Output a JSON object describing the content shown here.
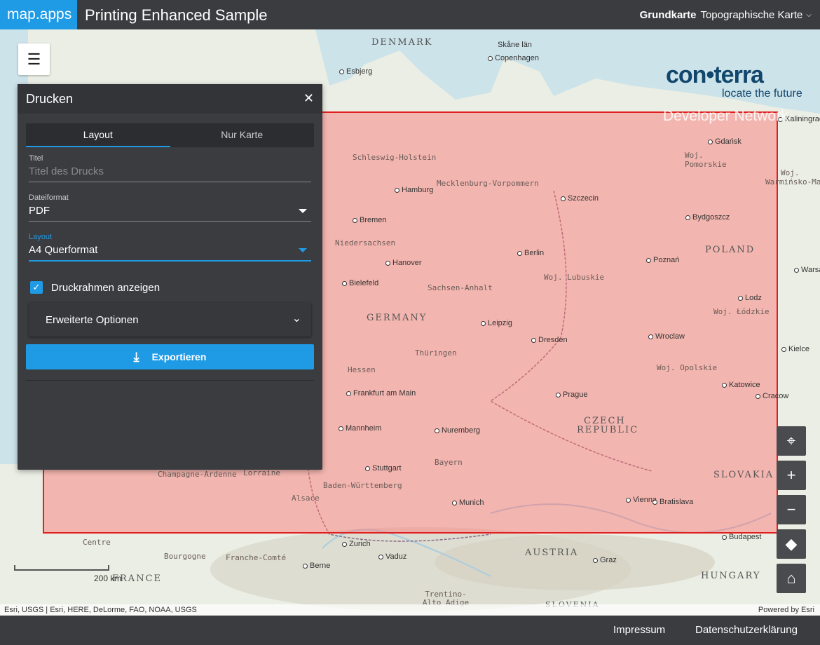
{
  "header": {
    "brand": "map.apps",
    "title": "Printing Enhanced Sample",
    "basemap_label": "Grundkarte",
    "basemap_value": "Topographische Karte"
  },
  "logo": {
    "main": "con•terra",
    "tagline": "locate the future",
    "network": "Developer Network"
  },
  "map": {
    "labels": [
      {
        "text": "DENMARK",
        "type": "country"
      },
      {
        "text": "Skåne län",
        "type": "plain"
      },
      {
        "text": "Copenhagen",
        "type": "city"
      },
      {
        "text": "Esbjerg",
        "type": "city"
      },
      {
        "text": "Schleswig-Holstein",
        "type": "region"
      },
      {
        "text": "Hamburg",
        "type": "city"
      },
      {
        "text": "Mecklenburg-Vorpommern",
        "type": "region"
      },
      {
        "text": "Szczecin",
        "type": "city"
      },
      {
        "text": "Gdańsk",
        "type": "city"
      },
      {
        "text": "Woj. Pomorskie",
        "type": "region"
      },
      {
        "text": "Bremen",
        "type": "city"
      },
      {
        "text": "Bydgoszcz",
        "type": "city"
      },
      {
        "text": "Niedersachsen",
        "type": "region"
      },
      {
        "text": "POLAND",
        "type": "country"
      },
      {
        "text": "Berlin",
        "type": "city"
      },
      {
        "text": "Hanover",
        "type": "city"
      },
      {
        "text": "Poznań",
        "type": "city"
      },
      {
        "text": "Woj. Lubuskie",
        "type": "region"
      },
      {
        "text": "Bielefeld",
        "type": "city"
      },
      {
        "text": "Sachsen-Anhalt",
        "type": "region"
      },
      {
        "text": "Lodz",
        "type": "city"
      },
      {
        "text": "Woj. Łódzkie",
        "type": "region"
      },
      {
        "text": "GERMANY",
        "type": "country"
      },
      {
        "text": "Leipzig",
        "type": "city"
      },
      {
        "text": "Dresden",
        "type": "city"
      },
      {
        "text": "Wroclaw",
        "type": "city"
      },
      {
        "text": "Thüringen",
        "type": "region"
      },
      {
        "text": "Woj. Opolskie",
        "type": "region"
      },
      {
        "text": "Hessen",
        "type": "region"
      },
      {
        "text": "Katowice",
        "type": "city"
      },
      {
        "text": "Frankfurt am Main",
        "type": "city"
      },
      {
        "text": "Prague",
        "type": "city"
      },
      {
        "text": "Cracow",
        "type": "city"
      },
      {
        "text": "CZECH",
        "type": "country"
      },
      {
        "text": "REPUBLIC",
        "type": "country"
      },
      {
        "text": "Mannheim",
        "type": "city"
      },
      {
        "text": "Nuremberg",
        "type": "city"
      },
      {
        "text": "Bayern",
        "type": "region"
      },
      {
        "text": "Stuttgart",
        "type": "city"
      },
      {
        "text": "SLOVAKIA",
        "type": "country"
      },
      {
        "text": "Champagne-Ardenne",
        "type": "region"
      },
      {
        "text": "Lorraine",
        "type": "region"
      },
      {
        "text": "Baden-Württemberg",
        "type": "region"
      },
      {
        "text": "Alsace",
        "type": "region"
      },
      {
        "text": "Munich",
        "type": "city"
      },
      {
        "text": "Vienna",
        "type": "city"
      },
      {
        "text": "Bratislava",
        "type": "city"
      },
      {
        "text": "Centre",
        "type": "region"
      },
      {
        "text": "Zurich",
        "type": "city"
      },
      {
        "text": "Budapest",
        "type": "city"
      },
      {
        "text": "Bourgogne",
        "type": "region"
      },
      {
        "text": "Franche-Comté",
        "type": "region"
      },
      {
        "text": "Vaduz",
        "type": "city"
      },
      {
        "text": "AUSTRIA",
        "type": "country"
      },
      {
        "text": "Graz",
        "type": "city"
      },
      {
        "text": "Berne",
        "type": "city"
      },
      {
        "text": "HUNGARY",
        "type": "country"
      },
      {
        "text": "Trentino-Alto Adige",
        "type": "region"
      },
      {
        "text": "SLOVENIA",
        "type": "country"
      },
      {
        "text": "Warsa",
        "type": "city"
      },
      {
        "text": "Kielce",
        "type": "city"
      },
      {
        "text": "Woj.",
        "type": "region"
      },
      {
        "text": "Warmińsko-Mazur",
        "type": "region"
      },
      {
        "text": "Kaliningrad",
        "type": "city"
      },
      {
        "text": "FRANCE",
        "type": "country"
      }
    ],
    "scale": "200 km",
    "attribution": "Esri, USGS | Esri, HERE, DeLorme, FAO, NOAA, USGS",
    "powered_by": "Powered by Esri"
  },
  "tools": [
    "locate-icon",
    "zoom-in-icon",
    "zoom-out-icon",
    "compass-icon",
    "home-icon"
  ],
  "panel": {
    "title": "Drucken",
    "tabs": [
      "Layout",
      "Nur Karte"
    ],
    "fields": {
      "title_label": "Titel",
      "title_placeholder": "Titel des Drucks",
      "format_label": "Dateiformat",
      "format_value": "PDF",
      "layout_label": "Layout",
      "layout_value": "A4 Querformat"
    },
    "checkbox_label": "Druckrahmen anzeigen",
    "advanced_label": "Erweiterte Optionen",
    "export_label": "Exportieren"
  },
  "footer": {
    "impressum": "Impressum",
    "privacy": "Datenschutzerklärung"
  },
  "colors": {
    "accent": "#1f9be6",
    "header": "#3b3c40",
    "frame_border": "#e02020"
  }
}
